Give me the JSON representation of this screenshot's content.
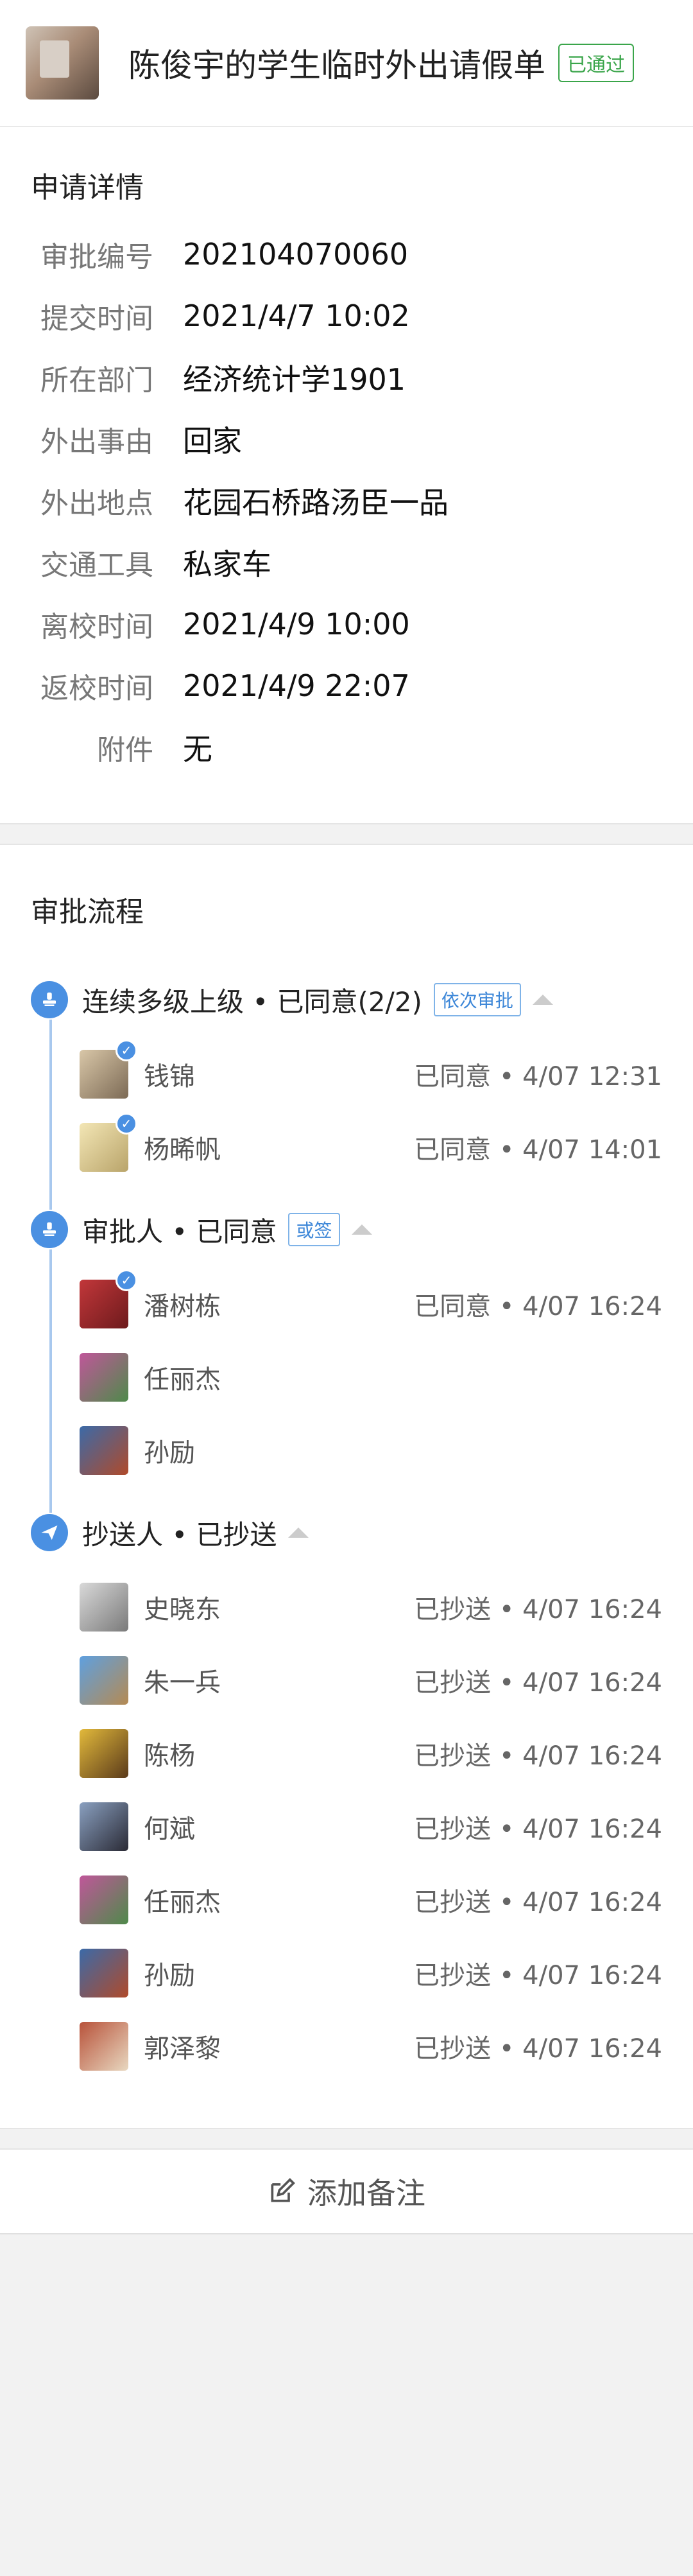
{
  "header": {
    "title": "陈俊宇的学生临时外出请假单",
    "status_badge": "已通过",
    "status_color": "#3aa54a"
  },
  "details": {
    "section_title": "申请详情",
    "rows": [
      {
        "key": "审批编号",
        "value": "202104070060"
      },
      {
        "key": "提交时间",
        "value": "2021/4/7 10:02"
      },
      {
        "key": "所在部门",
        "value": "经济统计学1901"
      },
      {
        "key": "外出事由",
        "value": "回家"
      },
      {
        "key": "外出地点",
        "value": "花园石桥路汤臣一品"
      },
      {
        "key": "交通工具",
        "value": "私家车"
      },
      {
        "key": "离校时间",
        "value": "2021/4/9 10:00"
      },
      {
        "key": "返校时间",
        "value": "2021/4/9 22:07"
      },
      {
        "key": "附件",
        "value": "无"
      }
    ]
  },
  "flow": {
    "section_title": "审批流程",
    "accent_color": "#4a90e2",
    "groups": [
      {
        "label": "连续多级上级 • 已同意(2/2)",
        "tag": "依次审批",
        "icon": "user-stamp-icon",
        "people": [
          {
            "name": "钱锦",
            "status": "已同意 • 4/07 12:31",
            "checked": true
          },
          {
            "name": "杨晞帆",
            "status": "已同意 • 4/07 14:01",
            "checked": true
          }
        ]
      },
      {
        "label": "审批人 • 已同意",
        "tag": "或签",
        "icon": "user-stamp-icon",
        "people": [
          {
            "name": "潘树栋",
            "status": "已同意 • 4/07 16:24",
            "checked": true
          },
          {
            "name": "任丽杰",
            "status": "",
            "checked": false
          },
          {
            "name": "孙励",
            "status": "",
            "checked": false
          }
        ]
      },
      {
        "label": "抄送人 • 已抄送",
        "tag": "",
        "icon": "paper-plane-icon",
        "people": [
          {
            "name": "史晓东",
            "status": "已抄送 • 4/07 16:24",
            "checked": false
          },
          {
            "name": "朱一兵",
            "status": "已抄送 • 4/07 16:24",
            "checked": false
          },
          {
            "name": "陈杨",
            "status": "已抄送 • 4/07 16:24",
            "checked": false
          },
          {
            "name": "何斌",
            "status": "已抄送 • 4/07 16:24",
            "checked": false
          },
          {
            "name": "任丽杰",
            "status": "已抄送 • 4/07 16:24",
            "checked": false
          },
          {
            "name": "孙励",
            "status": "已抄送 • 4/07 16:24",
            "checked": false
          },
          {
            "name": "郭泽黎",
            "status": "已抄送 • 4/07 16:24",
            "checked": false
          }
        ]
      }
    ]
  },
  "footer": {
    "add_note_label": "添加备注",
    "add_note_icon": "edit-icon"
  }
}
